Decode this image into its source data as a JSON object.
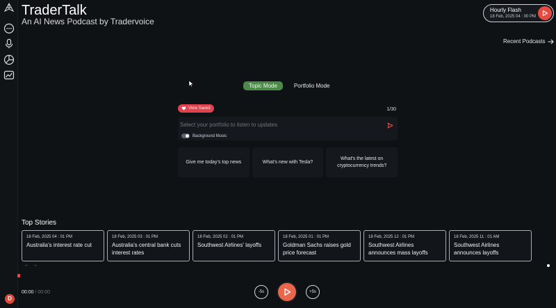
{
  "app": {
    "title": "TraderTalk",
    "subtitle": "An AI News Podcast by Tradervoice"
  },
  "sidebar": {
    "items": [
      {
        "icon": "logo-icon"
      },
      {
        "icon": "chat-icon"
      },
      {
        "icon": "microphone-icon"
      },
      {
        "icon": "pie-chart-icon"
      },
      {
        "icon": "trend-chart-icon"
      }
    ],
    "avatar_initial": "D"
  },
  "hourly_flash": {
    "title": "Hourly Flash",
    "time": "18 Feb, 2025 04 : 00 PM"
  },
  "recent_podcasts": {
    "label": "Recent Podcasts"
  },
  "modes": {
    "topic": "Topic Mode",
    "portfolio": "Portfolio Mode",
    "active": "topic"
  },
  "composer": {
    "view_saved": "View Saved",
    "counter": "1/30",
    "placeholder": "Select your portfolio to listen to updates",
    "value": "",
    "background_music_label": "Background Music"
  },
  "suggestions": [
    "Give me today's top news",
    "What's new with Tesla?",
    "What's the latest on cryptocurrency trends?"
  ],
  "top_stories": {
    "heading": "Top Stories",
    "items": [
      {
        "time": "18 Feb, 2025 04 : 01 PM",
        "title": "Australia's interest rate cut"
      },
      {
        "time": "18 Feb, 2025 03 : 01 PM",
        "title": "Australia's central bank cuts interest rates"
      },
      {
        "time": "18 Feb, 2025 02 : 01 PM",
        "title": "Southwest Airlines' layoffs"
      },
      {
        "time": "18 Feb, 2025 01 : 01 PM",
        "title": "Goldman Sachs raises gold price forecast"
      },
      {
        "time": "18 Feb, 2025 12 : 01 PM",
        "title": "Southwest Airlines announces mass layoffs"
      },
      {
        "time": "18 Feb, 2025 11 : 01 AM",
        "title": "Southwest Airlines announces layoffs"
      }
    ]
  },
  "player": {
    "current": "00:00",
    "separator": "/",
    "duration": "00:00",
    "rewind_label": "-5s",
    "forward_label": "+5s"
  },
  "colors": {
    "accent": "#e74b3f",
    "mode_active": "#4d8a4a",
    "saved_badge": "#e2414e",
    "background": "#0f1215"
  }
}
